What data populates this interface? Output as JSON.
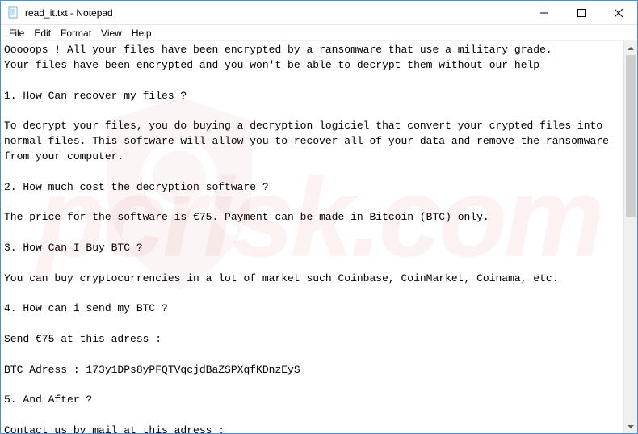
{
  "window": {
    "title": "read_it.txt - Notepad"
  },
  "menu": {
    "file": "File",
    "edit": "Edit",
    "format": "Format",
    "view": "View",
    "help": "Help"
  },
  "content": {
    "text": "Ooooops ! All your files have been encrypted by a ransomware that use a military grade.\nYour files have been encrypted and you won't be able to decrypt them without our help\n\n1. How Can recover my files ?\n\nTo decrypt your files, you do buying a decryption logiciel that convert your crypted files into normal files. This software will allow you to recover all of your data and remove the ransomware from your computer.\n\n2. How much cost the decryption software ?\n\nThe price for the software is €75. Payment can be made in Bitcoin (BTC) only.\n\n3. How Can I Buy BTC ?\n\nYou can buy cryptocurrencies in a lot of market such Coinbase, CoinMarket, Coinama, etc.\n\n4. How can i send my BTC ?\n\nSend €75 at this adress :\n\nBTC Adress : 173y1DPs8yPFQTVqcjdBaZSPXqfKDnzEyS\n\n5. And After ?\n\nContact us by mail at this adress :\n\nMail Adress : ouelezin.zebi@protonmail.com"
  },
  "watermark": {
    "text": "pcrisk.com"
  }
}
